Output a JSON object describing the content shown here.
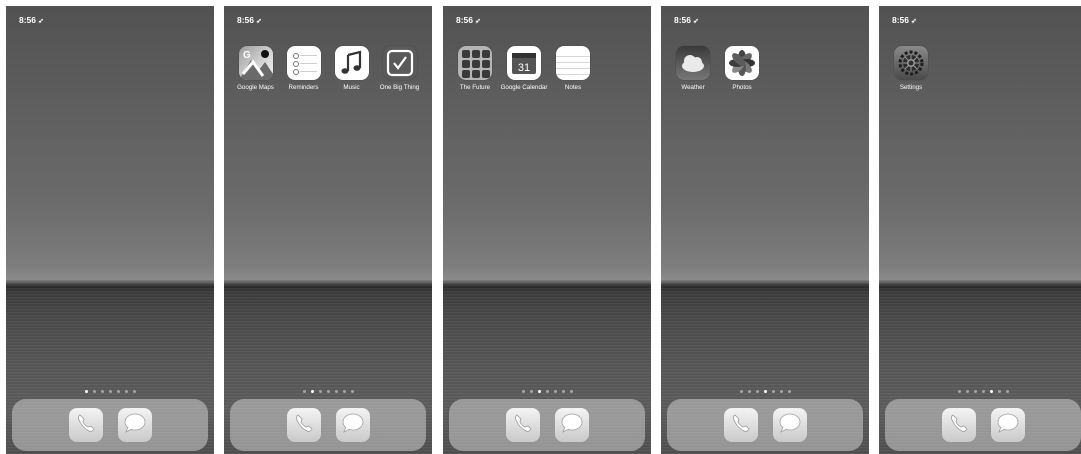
{
  "status": {
    "time": "8:56",
    "location_icon": "location-arrow-icon"
  },
  "screens": [
    {
      "apps": [],
      "active_page": 0
    },
    {
      "apps": [
        {
          "label": "Google Maps",
          "icon": "google-maps-icon"
        },
        {
          "label": "Reminders",
          "icon": "reminders-icon"
        },
        {
          "label": "Music",
          "icon": "music-icon"
        },
        {
          "label": "One Big Thing",
          "icon": "checkmark-icon"
        }
      ],
      "active_page": 1
    },
    {
      "apps": [
        {
          "label": "The Future",
          "icon": "folder-icon"
        },
        {
          "label": "Google Calendar",
          "icon": "calendar-icon",
          "date": "31"
        },
        {
          "label": "Notes",
          "icon": "notes-icon"
        }
      ],
      "active_page": 2
    },
    {
      "apps": [
        {
          "label": "Weather",
          "icon": "weather-icon"
        },
        {
          "label": "Photos",
          "icon": "photos-icon"
        }
      ],
      "active_page": 3
    },
    {
      "apps": [
        {
          "label": "Settings",
          "icon": "settings-gear-icon"
        }
      ],
      "active_page": 4
    }
  ],
  "page_count": 7,
  "dock": [
    {
      "name": "Phone",
      "icon": "phone-icon"
    },
    {
      "name": "Messages",
      "icon": "messages-icon"
    }
  ]
}
